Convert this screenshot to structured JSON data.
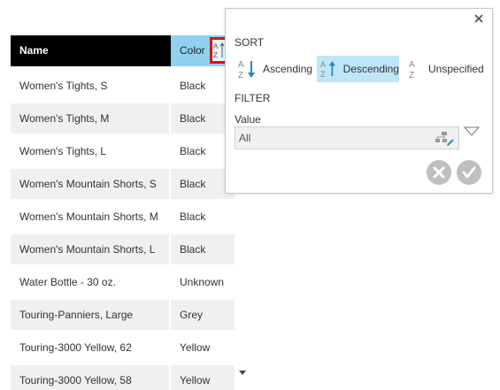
{
  "table": {
    "headers": {
      "name": "Name",
      "color": "Color"
    },
    "rows": [
      {
        "name": "Women's Tights, S",
        "color": "Black"
      },
      {
        "name": "Women's Tights, M",
        "color": "Black"
      },
      {
        "name": "Women's Tights, L",
        "color": "Black"
      },
      {
        "name": "Women's Mountain Shorts, S",
        "color": "Black"
      },
      {
        "name": "Women's Mountain Shorts, M",
        "color": "Black"
      },
      {
        "name": "Women's Mountain Shorts, L",
        "color": "Black"
      },
      {
        "name": "Water Bottle - 30 oz.",
        "color": "Unknown"
      },
      {
        "name": "Touring-Panniers, Large",
        "color": "Grey"
      },
      {
        "name": "Touring-3000 Yellow, 62",
        "color": "Yellow"
      },
      {
        "name": "Touring-3000 Yellow, 58",
        "color": "Yellow"
      }
    ]
  },
  "popup": {
    "sort_title": "SORT",
    "sort_options": [
      {
        "label": "Ascending",
        "icon": "sort-ascending-icon",
        "selected": false
      },
      {
        "label": "Descending",
        "icon": "sort-descending-icon",
        "selected": true
      },
      {
        "label": "Unspecified",
        "icon": "sort-unspecified-icon",
        "selected": false
      }
    ],
    "filter_title": "FILTER",
    "value_label": "Value",
    "value": "All"
  },
  "colors": {
    "header_bg": "#000000",
    "sorted_header_bg": "#8fd1ef",
    "selected_option_bg": "#bfe6f8",
    "highlight_border": "#e01010",
    "action_button": "#bfbfbf"
  }
}
